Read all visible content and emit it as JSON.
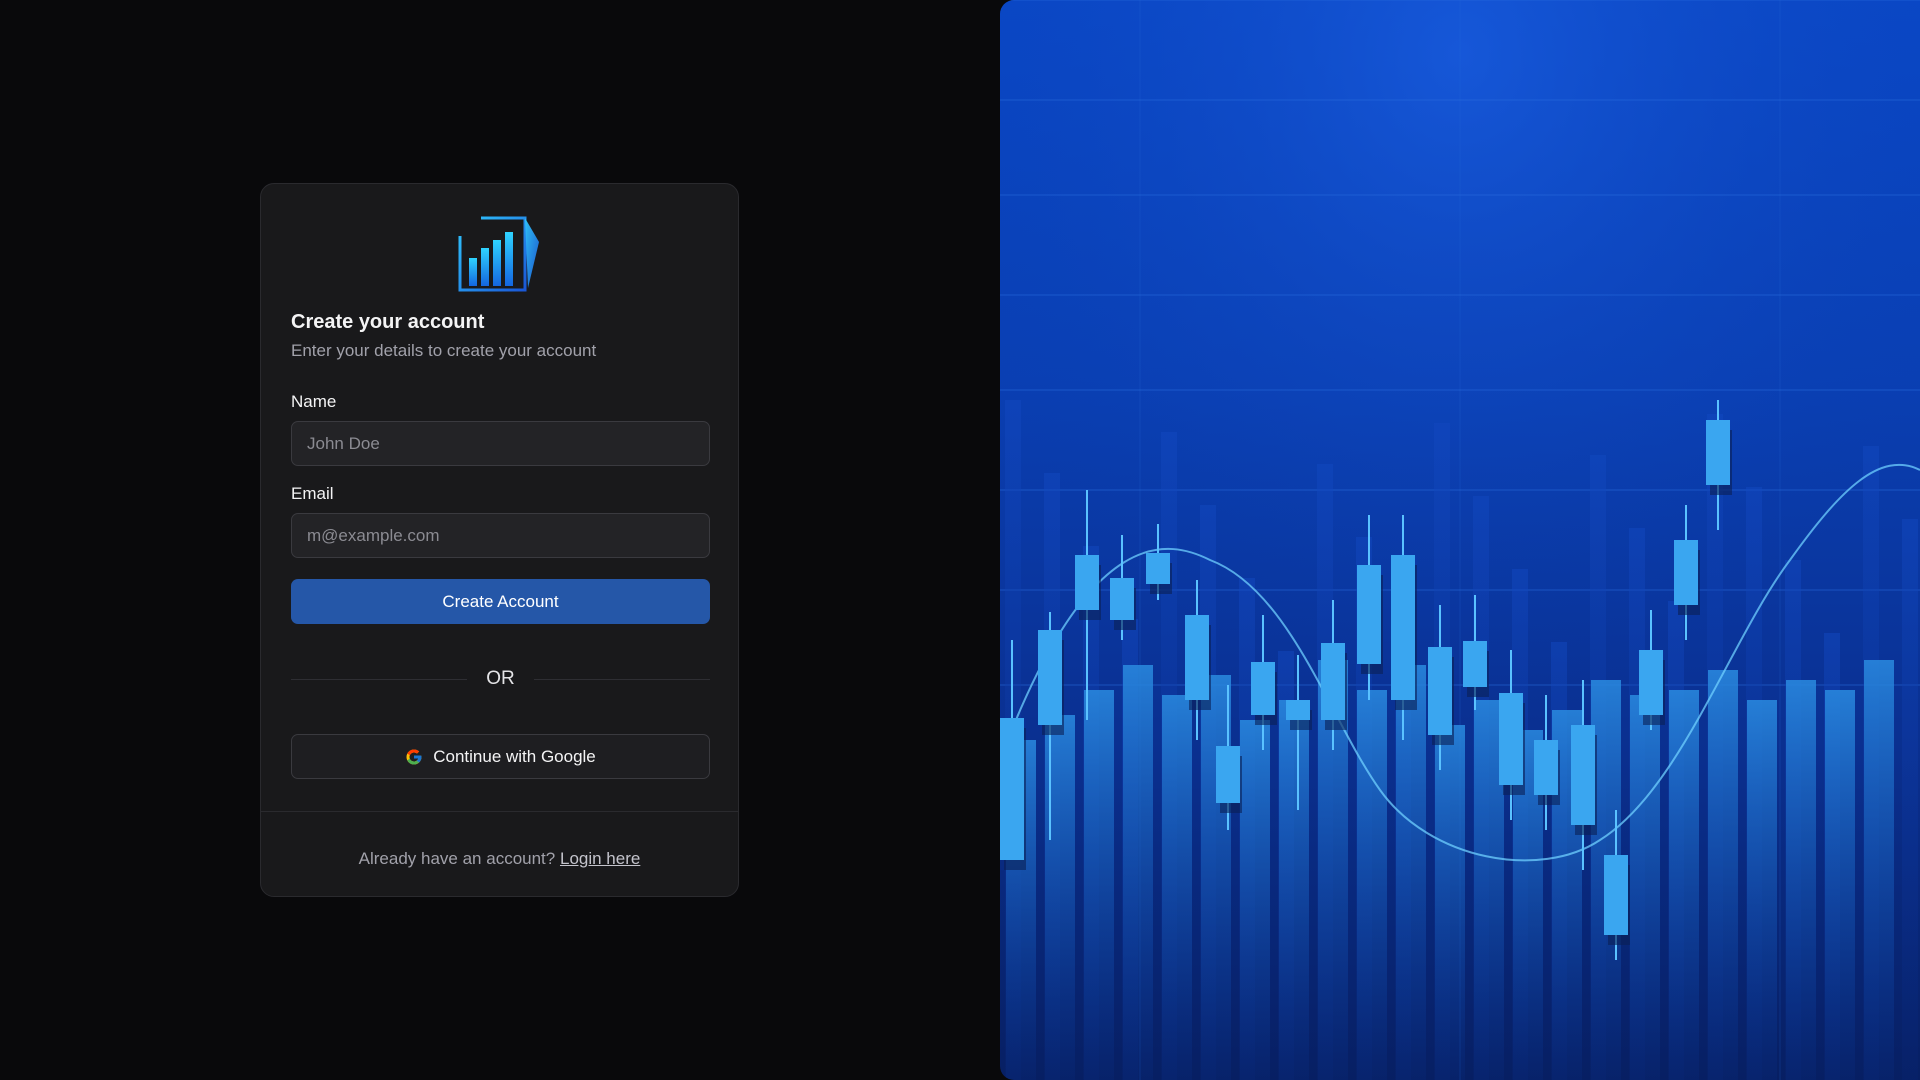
{
  "logo": {
    "icon": "bar-chart-logo-icon"
  },
  "signup": {
    "title": "Create your account",
    "subtitle": "Enter your details to create your account",
    "name_label": "Name",
    "name_placeholder": "John Doe",
    "email_label": "Email",
    "email_placeholder": "m@example.com",
    "submit_label": "Create Account",
    "divider_text": "OR",
    "google_label": "Continue with Google",
    "footer_text": "Already have an account?",
    "login_link": "Login here"
  },
  "colors": {
    "background": "#09090b",
    "card": "#19191b",
    "primary": "#2557a8",
    "hero_blue": "#0a47c6"
  },
  "hero": {
    "icon": "candlestick-chart-illustration"
  }
}
